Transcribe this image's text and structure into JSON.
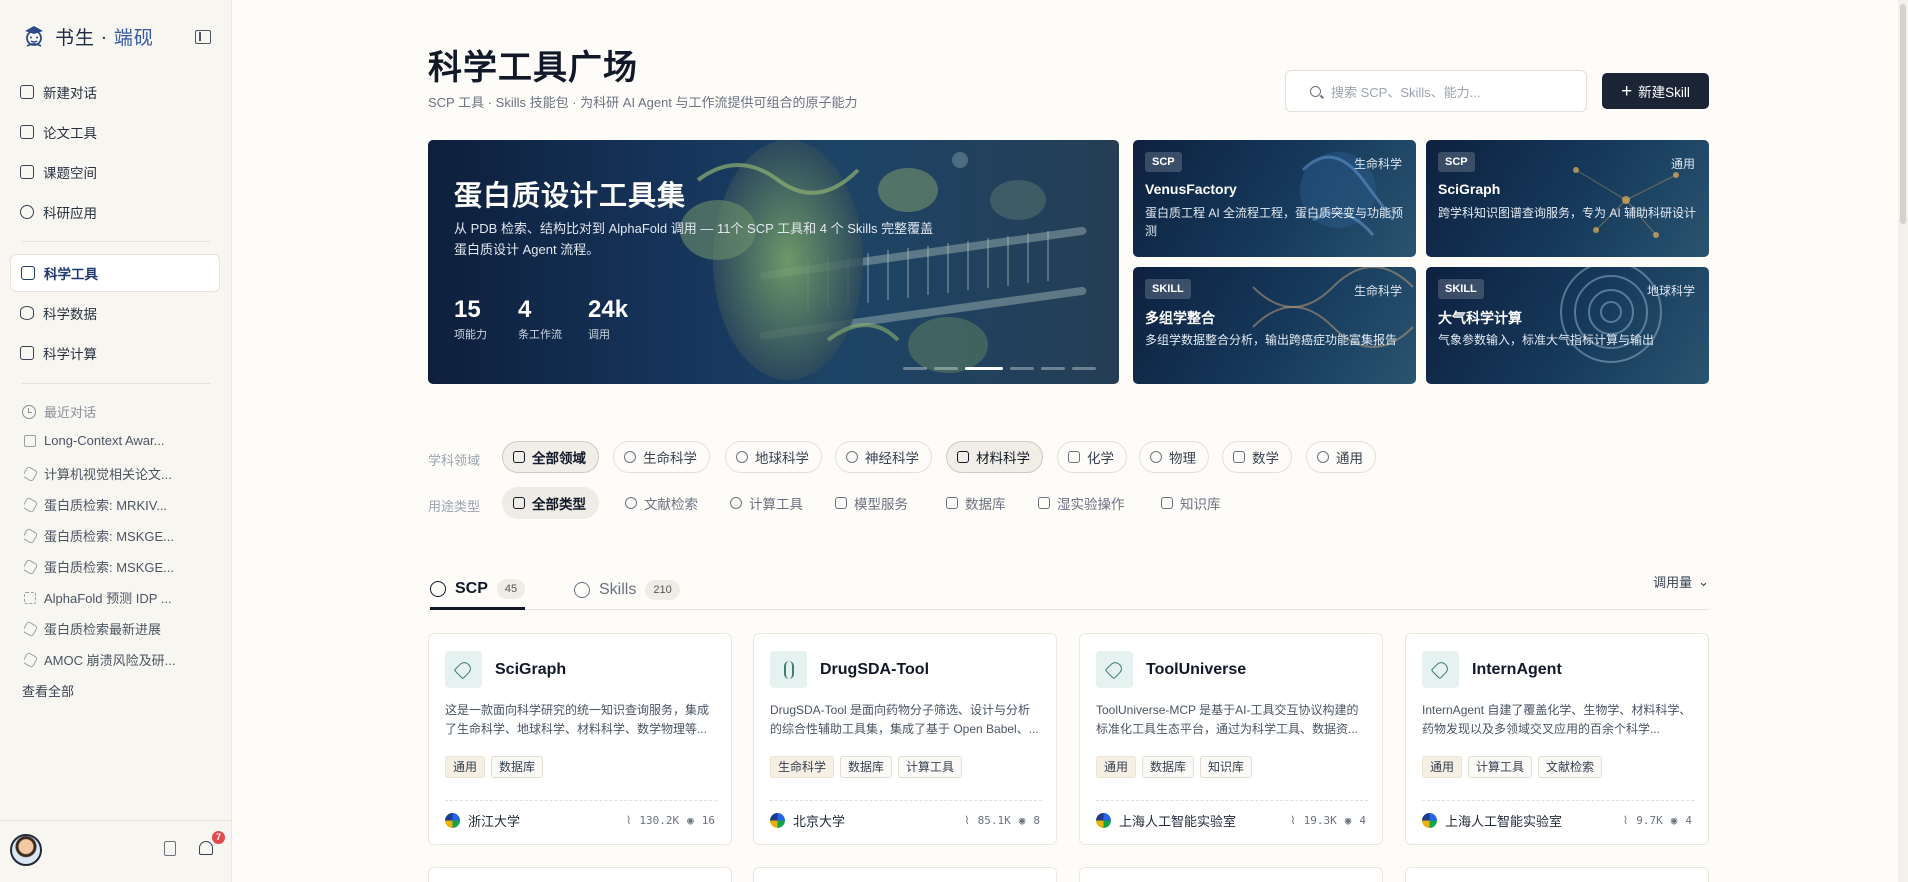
{
  "app": {
    "name": "书生",
    "dot": " · ",
    "subname": "端砚"
  },
  "nav": [
    {
      "label": "新建对话",
      "icon": "plus-square-icon"
    },
    {
      "label": "论文工具",
      "icon": "document-icon"
    },
    {
      "label": "课题空间",
      "icon": "books-icon"
    },
    {
      "label": "科研应用",
      "icon": "cube-icon"
    },
    {
      "label": "科学工具",
      "icon": "toolbox-icon",
      "active": true
    },
    {
      "label": "科学数据",
      "icon": "database-icon"
    },
    {
      "label": "科学计算",
      "icon": "monitor-icon"
    }
  ],
  "recent": {
    "title": "最近对话",
    "items": [
      "Long-Context Awar...",
      "计算机视觉相关论文...",
      "蛋白质检索: MRKIV...",
      "蛋白质检索: MSKGE...",
      "蛋白质检索: MSKGE...",
      "AlphaFold 预测 IDP ...",
      "蛋白质检索最新进展",
      "AMOC 崩溃风险及研..."
    ],
    "see_all": "查看全部"
  },
  "notifications": {
    "count": "7"
  },
  "header": {
    "title": "科学工具广场",
    "subtitle": "SCP 工具 · Skills 技能包 · 为科研 AI Agent 与工作流提供可组合的原子能力",
    "search_placeholder": "搜索 SCP、Skills、能力...",
    "new_button": "新建Skill"
  },
  "hero": {
    "title": "蛋白质设计工具集",
    "desc": "从 PDB 检索、结构比对到 AlphaFold 调用 — 11个 SCP 工具和 4 个 Skills 完整覆盖蛋白质设计 Agent 流程。",
    "stats": [
      {
        "num": "15",
        "label": "项能力"
      },
      {
        "num": "4",
        "label": "条工作流"
      },
      {
        "num": "24k",
        "label": "调用"
      }
    ],
    "slides": 6,
    "active_slide": 3
  },
  "featured": [
    {
      "tag": "SCP",
      "domain": "生命科学",
      "name": "VenusFactory",
      "desc": "蛋白质工程 AI 全流程工程，蛋白质突变与功能预测"
    },
    {
      "tag": "SCP",
      "domain": "通用",
      "name": "SciGraph",
      "desc": "跨学科知识图谱查询服务，专为 AI 辅助科研设计"
    },
    {
      "tag": "SKILL",
      "domain": "生命科学",
      "name": "多组学整合",
      "desc": "多组学数据整合分析，输出跨癌症功能富集报告"
    },
    {
      "tag": "SKILL",
      "domain": "地球科学",
      "name": "大气科学计算",
      "desc": "气象参数输入，标准大气指标计算与输出"
    }
  ],
  "filters": {
    "domain_label": "学科领域",
    "domains": [
      "全部领域",
      "生命科学",
      "地球科学",
      "神经科学",
      "材料科学",
      "化学",
      "物理",
      "数学",
      "通用"
    ],
    "type_label": "用途类型",
    "types": [
      "全部类型",
      "文献检索",
      "计算工具",
      "模型服务",
      "数据库",
      "湿实验操作",
      "知识库"
    ]
  },
  "tabs": [
    {
      "label": "SCP",
      "count": "45"
    },
    {
      "label": "Skills",
      "count": "210"
    }
  ],
  "sort_label": "调用量",
  "cards": [
    {
      "name": "SciGraph",
      "icon": "tag-icon",
      "desc": "这是一款面向科学研究的统一知识查询服务，集成了生命科学、地球科学、材料科学、数学物理等...",
      "tags": [
        "通用",
        "数据库"
      ],
      "org": "浙江大学",
      "calls": "130.2K",
      "views": "16"
    },
    {
      "name": "DrugSDA-Tool",
      "icon": "dna-icon",
      "desc": "DrugSDA-Tool 是面向药物分子筛选、设计与分析的综合性辅助工具集，集成了基于 Open Babel、...",
      "tags": [
        "生命科学",
        "数据库",
        "计算工具"
      ],
      "org": "北京大学",
      "calls": "85.1K",
      "views": "8"
    },
    {
      "name": "ToolUniverse",
      "icon": "tag-icon",
      "desc": "ToolUniverse-MCP 是基于AI-工具交互协议构建的标准化工具生态平台，通过为科学工具、数据资...",
      "tags": [
        "通用",
        "数据库",
        "知识库"
      ],
      "org": "上海人工智能实验室",
      "calls": "19.3K",
      "views": "4"
    },
    {
      "name": "InternAgent",
      "icon": "tag-icon",
      "desc": "InternAgent 自建了覆盖化学、生物学、材料科学、药物发现以及多领域交叉应用的百余个科学...",
      "tags": [
        "通用",
        "计算工具",
        "文献检索"
      ],
      "org": "上海人工智能实验室",
      "calls": "9.7K",
      "views": "4"
    }
  ]
}
